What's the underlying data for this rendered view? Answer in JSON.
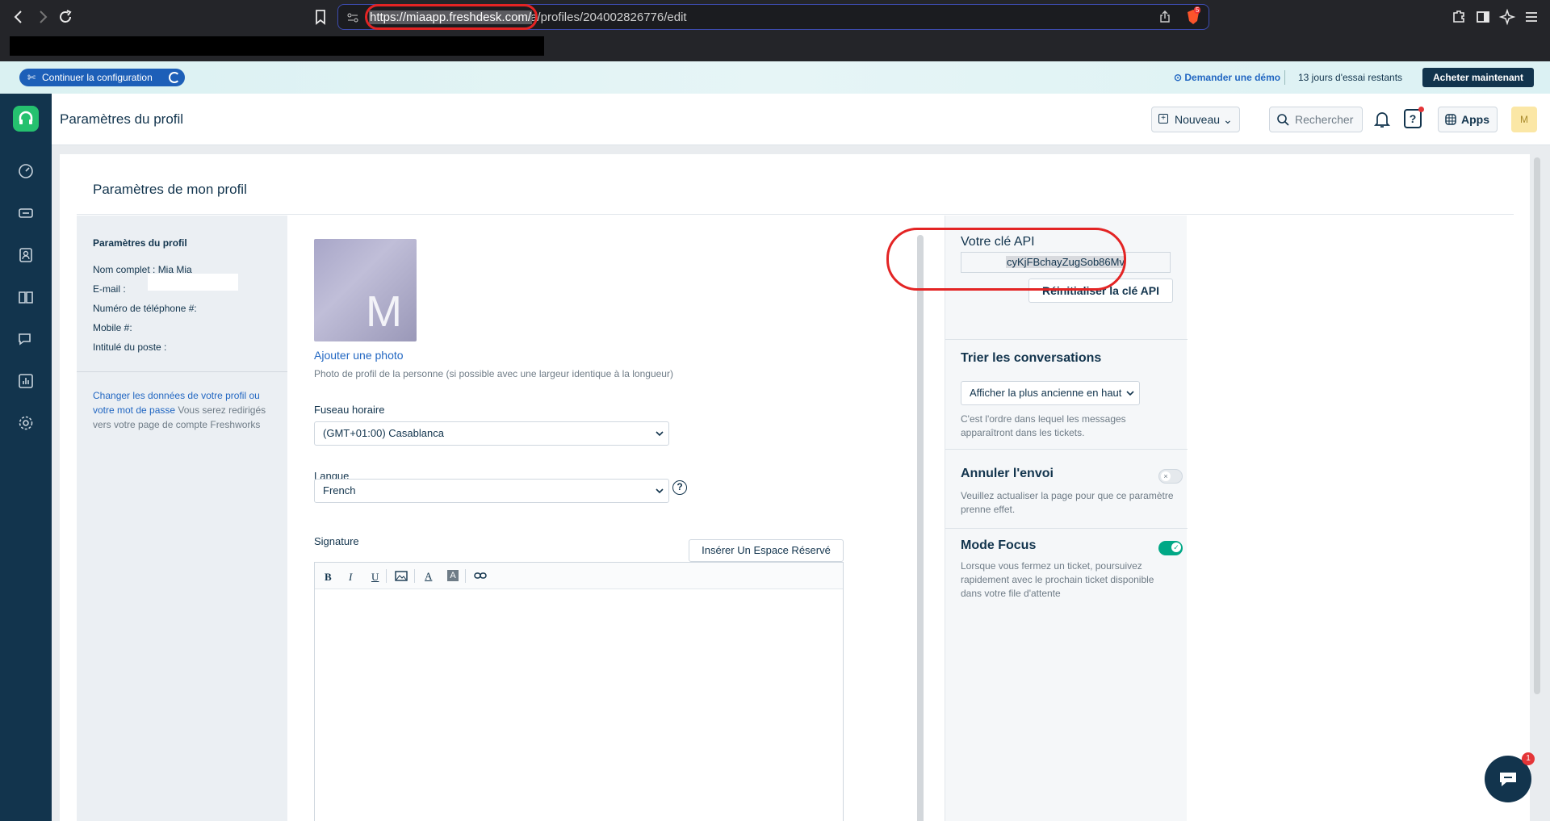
{
  "browser": {
    "url_host": "https://miaapp.freshdesk.com/",
    "url_path": "a/profiles/204002826776/edit",
    "shield_count": "5"
  },
  "banner": {
    "setup_label": "Continuer la configuration",
    "demo_label": "Demander une démo",
    "trial_text": "13 jours d'essai restants",
    "buy_label": "Acheter maintenant"
  },
  "topbar": {
    "title": "Paramètres du profil",
    "new_label": "Nouveau",
    "search_label": "Rechercher",
    "apps_label": "Apps",
    "avatar_letter": "M"
  },
  "card": {
    "title": "Paramètres de mon profil"
  },
  "profile": {
    "heading": "Paramètres du profil",
    "full_name": "Nom complet : Mia Mia",
    "email_label": "E-mail :",
    "phone_label": "Numéro de téléphone #:",
    "mobile_label": "Mobile #:",
    "job_label": "Intitulé du poste :",
    "change_link": "Changer les données de votre profil ou votre mot de passe",
    "change_rest": " Vous serez redirigés vers votre page de compte Freshworks"
  },
  "photo": {
    "letter": "M",
    "add_label": "Ajouter une photo",
    "hint": "Photo de profil de la personne (si possible avec une largeur identique à la longueur)"
  },
  "timezone": {
    "label": "Fuseau horaire",
    "value": "(GMT+01:00) Casablanca"
  },
  "language": {
    "label": "Langue",
    "value": "French"
  },
  "signature": {
    "label": "Signature",
    "insert_label": "Insérer Un Espace Réservé",
    "toolbar": [
      "B",
      "I",
      "U"
    ]
  },
  "api": {
    "title": "Votre clé API",
    "key": "cyKjFBchayZugSob86Mv",
    "reset_label": "Réinitialiser la clé API"
  },
  "sort": {
    "title": "Trier les conversations",
    "value": "Afficher la plus ancienne en haut",
    "desc": "C'est l'ordre dans lequel les messages apparaîtront dans les tickets."
  },
  "undo": {
    "title": "Annuler l'envoi",
    "desc": "Veuillez actualiser la page pour que ce paramètre prenne effet.",
    "enabled": false
  },
  "focus": {
    "title": "Mode Focus",
    "desc": "Lorsque vous fermez un ticket, poursuivez rapidement avec le prochain ticket disponible dans votre file d'attente",
    "enabled": true
  },
  "chat": {
    "badge": "1"
  },
  "colors": {
    "accent": "#2267c2",
    "navy": "#12344d",
    "toggle_on": "#00a886",
    "highlight": "#e32424"
  }
}
